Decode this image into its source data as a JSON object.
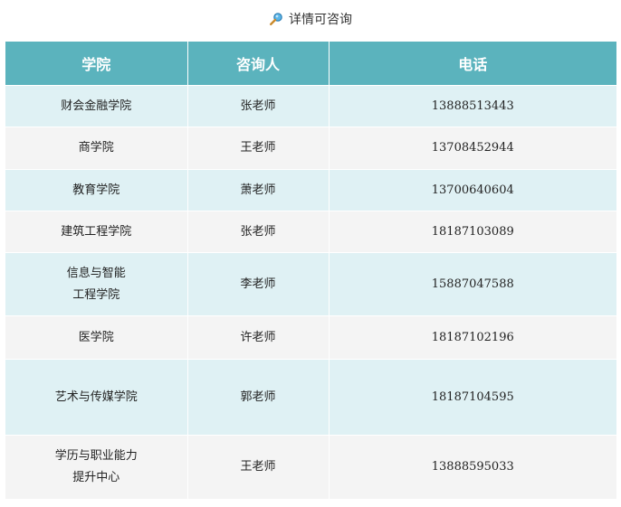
{
  "title": {
    "icon": "magnifier-icon",
    "text": "详情可咨询"
  },
  "table": {
    "headers": [
      "学院",
      "咨询人",
      "电话"
    ],
    "rows": [
      {
        "college": [
          "财会金融学院"
        ],
        "contact": "张老师",
        "phone": "13888513443"
      },
      {
        "college": [
          "商学院"
        ],
        "contact": "王老师",
        "phone": "13708452944"
      },
      {
        "college": [
          "教育学院"
        ],
        "contact": "萧老师",
        "phone": "13700640604"
      },
      {
        "college": [
          "建筑工程学院"
        ],
        "contact": "张老师",
        "phone": "18187103089"
      },
      {
        "college": [
          "信息与智能",
          "工程学院"
        ],
        "contact": "李老师",
        "phone": "15887047588"
      },
      {
        "college": [
          "医学院"
        ],
        "contact": "许老师",
        "phone": "18187102196"
      },
      {
        "college": [
          "艺术与传媒学院"
        ],
        "contact": "郭老师",
        "phone": "18187104595"
      },
      {
        "college": [
          "学历与职业能力",
          "提升中心"
        ],
        "contact": "王老师",
        "phone": "13888595033"
      }
    ]
  },
  "colors": {
    "header_bg": "#5bb3bd",
    "row_odd_bg": "#dff1f4",
    "row_even_bg": "#f4f4f4"
  }
}
